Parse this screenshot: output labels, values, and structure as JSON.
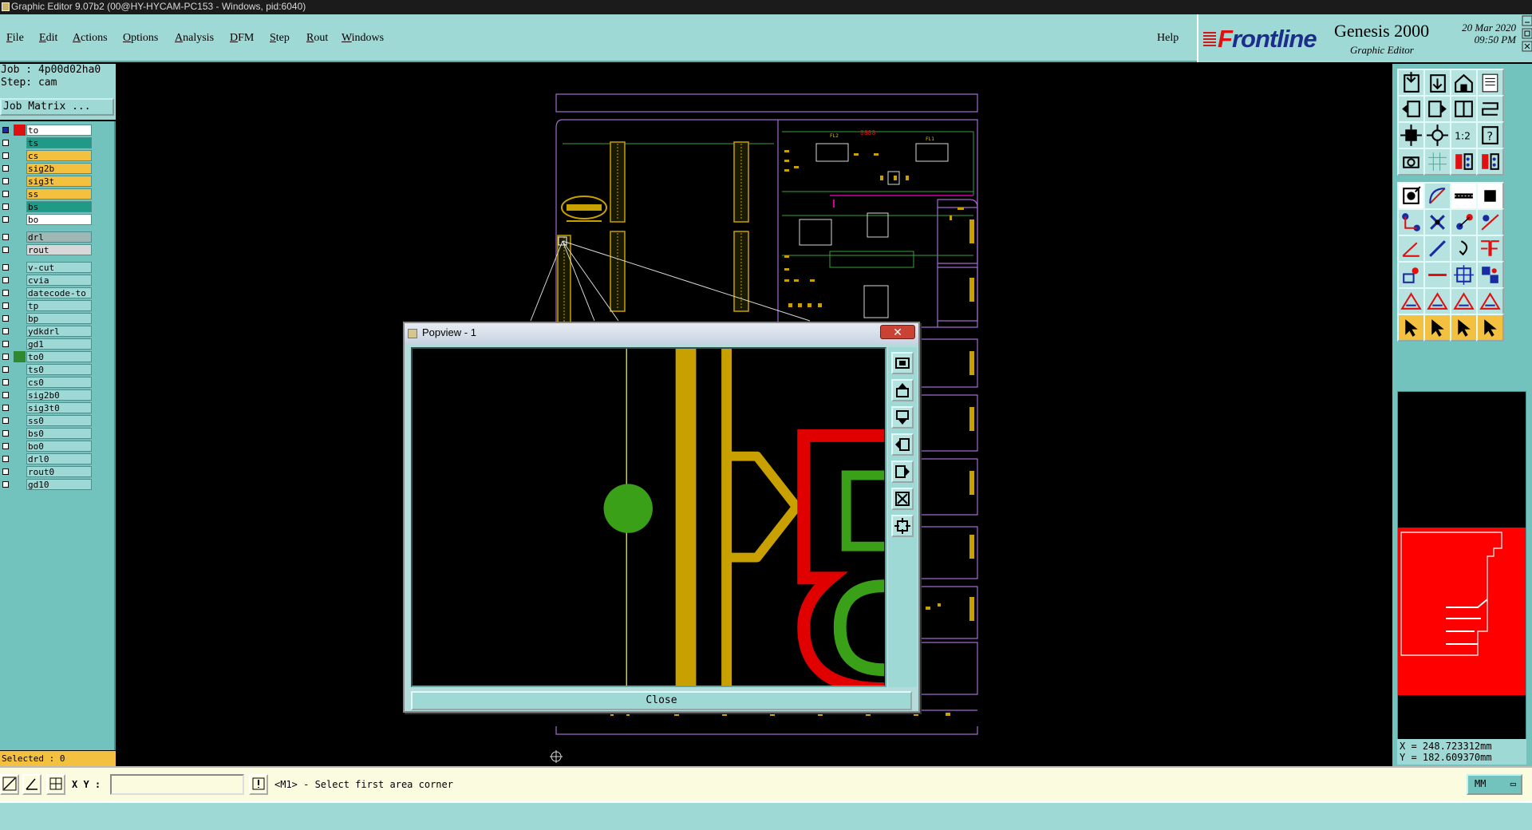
{
  "window": {
    "title": "Graphic Editor 9.07b2 (00@HY-HYCAM-PC153 - Windows, pid:6040)"
  },
  "menu": [
    {
      "label": "File"
    },
    {
      "label": "Edit"
    },
    {
      "label": "Actions"
    },
    {
      "label": "Options"
    },
    {
      "label": "Analysis"
    },
    {
      "label": "DFM"
    },
    {
      "label": "Step"
    },
    {
      "label": "Rout"
    },
    {
      "label": "Windows"
    }
  ],
  "help_label": "Help",
  "brand": {
    "logo": "Frontline",
    "product": "Genesis 2000",
    "subtitle": "Graphic Editor",
    "date": "20 Mar 2020",
    "time": "09:50 PM"
  },
  "job": {
    "job_line": "Job : 4p00d02ha0",
    "step_line": "Step: cam",
    "matrix_label": "Job Matrix ..."
  },
  "layers": [
    {
      "name": "to",
      "color": "#ffffff",
      "swatch": "#e01010",
      "active": true
    },
    {
      "name": "ts",
      "color": "#1f9a86",
      "swatch": "#72c2bd"
    },
    {
      "name": "cs",
      "color": "#f3c040",
      "swatch": "#72c2bd"
    },
    {
      "name": "sig2b",
      "color": "#f3c040",
      "swatch": "#72c2bd"
    },
    {
      "name": "sig3t",
      "color": "#f3c040",
      "swatch": "#72c2bd"
    },
    {
      "name": "ss",
      "color": "#f3c040",
      "swatch": "#72c2bd"
    },
    {
      "name": "bs",
      "color": "#1f9a86",
      "swatch": "#72c2bd"
    },
    {
      "name": "bo",
      "color": "#ffffff",
      "swatch": "#72c2bd"
    },
    {
      "name": "drl",
      "color": "#9fb8b6",
      "swatch": "#72c2bd"
    },
    {
      "name": "rout",
      "color": "#d8d8d8",
      "swatch": "#72c2bd"
    },
    {
      "name": "v-cut",
      "color": "#9fd9d6",
      "swatch": "#72c2bd"
    },
    {
      "name": "cvia",
      "color": "#9fd9d6",
      "swatch": "#72c2bd"
    },
    {
      "name": "datecode-to",
      "color": "#9fd9d6",
      "swatch": "#72c2bd"
    },
    {
      "name": "tp",
      "color": "#9fd9d6",
      "swatch": "#72c2bd"
    },
    {
      "name": "bp",
      "color": "#9fd9d6",
      "swatch": "#72c2bd"
    },
    {
      "name": "ydkdrl",
      "color": "#9fd9d6",
      "swatch": "#72c2bd"
    },
    {
      "name": "gd1",
      "color": "#9fd9d6",
      "swatch": "#72c2bd"
    },
    {
      "name": "to0",
      "color": "#9fd9d6",
      "swatch": "#2f8a2f"
    },
    {
      "name": "ts0",
      "color": "#9fd9d6",
      "swatch": "#72c2bd"
    },
    {
      "name": "cs0",
      "color": "#9fd9d6",
      "swatch": "#72c2bd"
    },
    {
      "name": "sig2b0",
      "color": "#9fd9d6",
      "swatch": "#72c2bd"
    },
    {
      "name": "sig3t0",
      "color": "#9fd9d6",
      "swatch": "#72c2bd"
    },
    {
      "name": "ss0",
      "color": "#9fd9d6",
      "swatch": "#72c2bd"
    },
    {
      "name": "bs0",
      "color": "#9fd9d6",
      "swatch": "#72c2bd"
    },
    {
      "name": "bo0",
      "color": "#9fd9d6",
      "swatch": "#72c2bd"
    },
    {
      "name": "drl0",
      "color": "#9fd9d6",
      "swatch": "#72c2bd"
    },
    {
      "name": "rout0",
      "color": "#9fd9d6",
      "swatch": "#72c2bd"
    },
    {
      "name": "gd10",
      "color": "#9fd9d6",
      "swatch": "#72c2bd"
    }
  ],
  "selected": "Selected : 0",
  "coords": {
    "x": "X = 248.723312mm",
    "y": "Y = 182.609370mm"
  },
  "bottom": {
    "xy_label": "X Y :",
    "xy_value": "",
    "prompt": "<M1> - Select first area corner",
    "units": "MM"
  },
  "popview": {
    "title": "Popview - 1",
    "close_label": "Close",
    "close_x": "✕"
  },
  "canvas_labels": {
    "chip1": "FL2",
    "chip2": "FL1",
    "chip3": "8888"
  }
}
